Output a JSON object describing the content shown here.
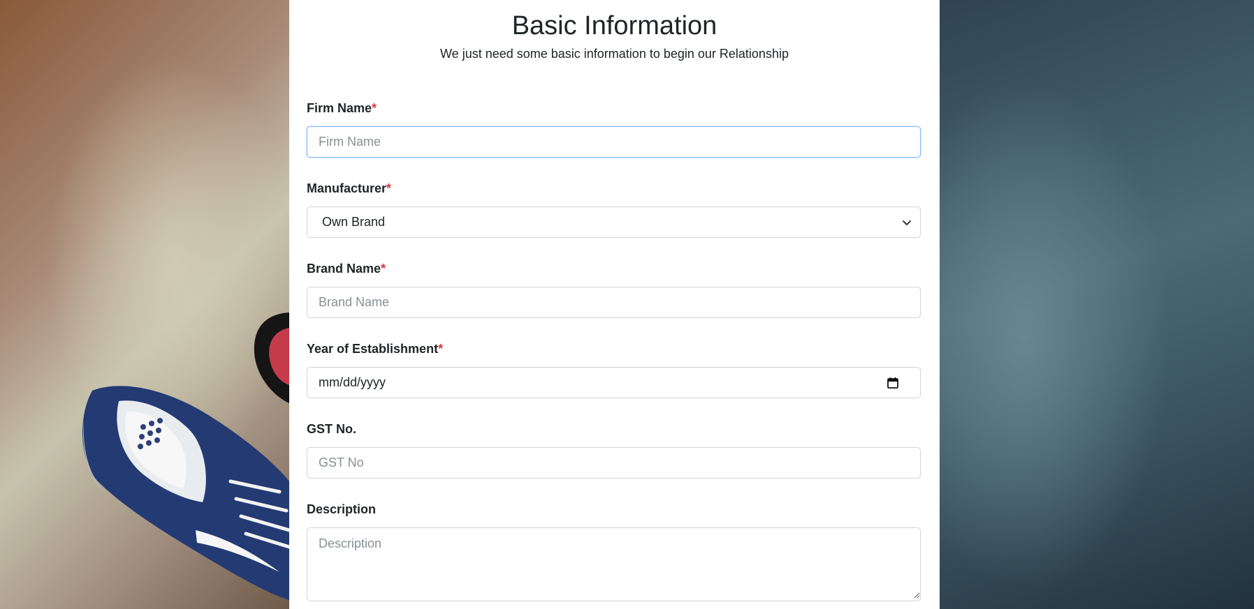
{
  "form": {
    "title": "Basic Information",
    "subtitle": "We just need some basic information to begin our Relationship",
    "required_mark": "*",
    "fields": {
      "firm_name": {
        "label": "Firm Name",
        "placeholder": "Firm Name",
        "value": ""
      },
      "manufacturer": {
        "label": "Manufacturer",
        "selected": "Own Brand"
      },
      "brand_name": {
        "label": "Brand Name",
        "placeholder": "Brand Name",
        "value": ""
      },
      "year_of_establishment": {
        "label": "Year of Establishment",
        "placeholder": "mm/dd/yyyy"
      },
      "gst_no": {
        "label": "GST No.",
        "placeholder": "GST No",
        "value": ""
      },
      "description": {
        "label": "Description",
        "placeholder": "Description",
        "value": ""
      }
    }
  },
  "icons": {
    "select_arrow": "chevron-down-icon",
    "date_picker": "calendar-icon",
    "textarea_resize": "resize-grip-icon"
  },
  "colors": {
    "required": "#dc3545",
    "focus_border": "#86b7fe",
    "input_border": "#ced4da",
    "text": "#212529"
  }
}
